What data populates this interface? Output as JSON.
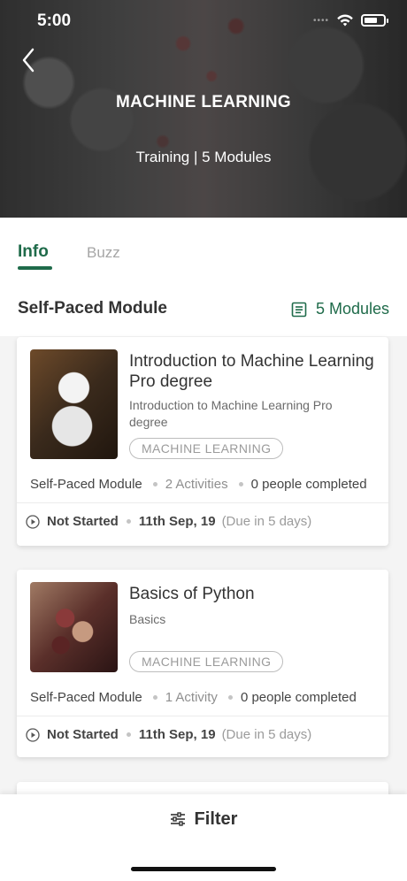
{
  "status_bar": {
    "time": "5:00",
    "signal_dots": "••••"
  },
  "hero": {
    "title": "MACHINE LEARNING",
    "subtitle": "Training | 5 Modules"
  },
  "tabs": [
    {
      "label": "Info",
      "active": true
    },
    {
      "label": "Buzz",
      "active": false
    }
  ],
  "section": {
    "title": "Self-Paced Module",
    "module_count": "5 Modules"
  },
  "cards": [
    {
      "title": "Introduction to Machine Learning Pro degree",
      "description": "Introduction to Machine Learning Pro degree",
      "tag": "MACHINE LEARNING",
      "type": "Self-Paced Module",
      "activities": "2 Activities",
      "completed": "0 people completed",
      "status": "Not Started",
      "date": "11th Sep, 19",
      "due": "(Due in 5 days)"
    },
    {
      "title": "Basics of Python",
      "description": "Basics",
      "tag": "MACHINE LEARNING",
      "type": "Self-Paced Module",
      "activities": "1 Activity",
      "completed": "0 people completed",
      "status": "Not Started",
      "date": "11th Sep, 19",
      "due": "(Due in 5 days)"
    }
  ],
  "filter": {
    "label": "Filter"
  },
  "colors": {
    "accent": "#1f6b4a",
    "muted": "#9b9b9b"
  },
  "icons": {
    "back": "chevron-left-icon",
    "modules": "list-icon",
    "filter": "sliders-icon",
    "status": "play-circle-icon"
  }
}
